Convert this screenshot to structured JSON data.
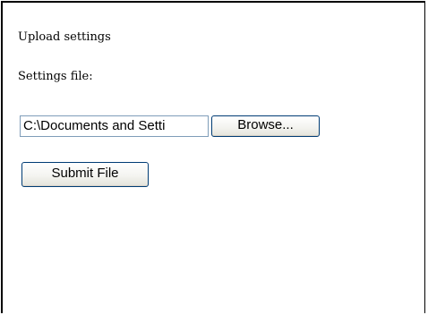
{
  "form": {
    "heading": "Upload settings",
    "file_label": "Settings file:",
    "file_input_value": "C:\\Documents and Setti",
    "browse_label": "Browse...",
    "submit_label": "Submit File"
  }
}
